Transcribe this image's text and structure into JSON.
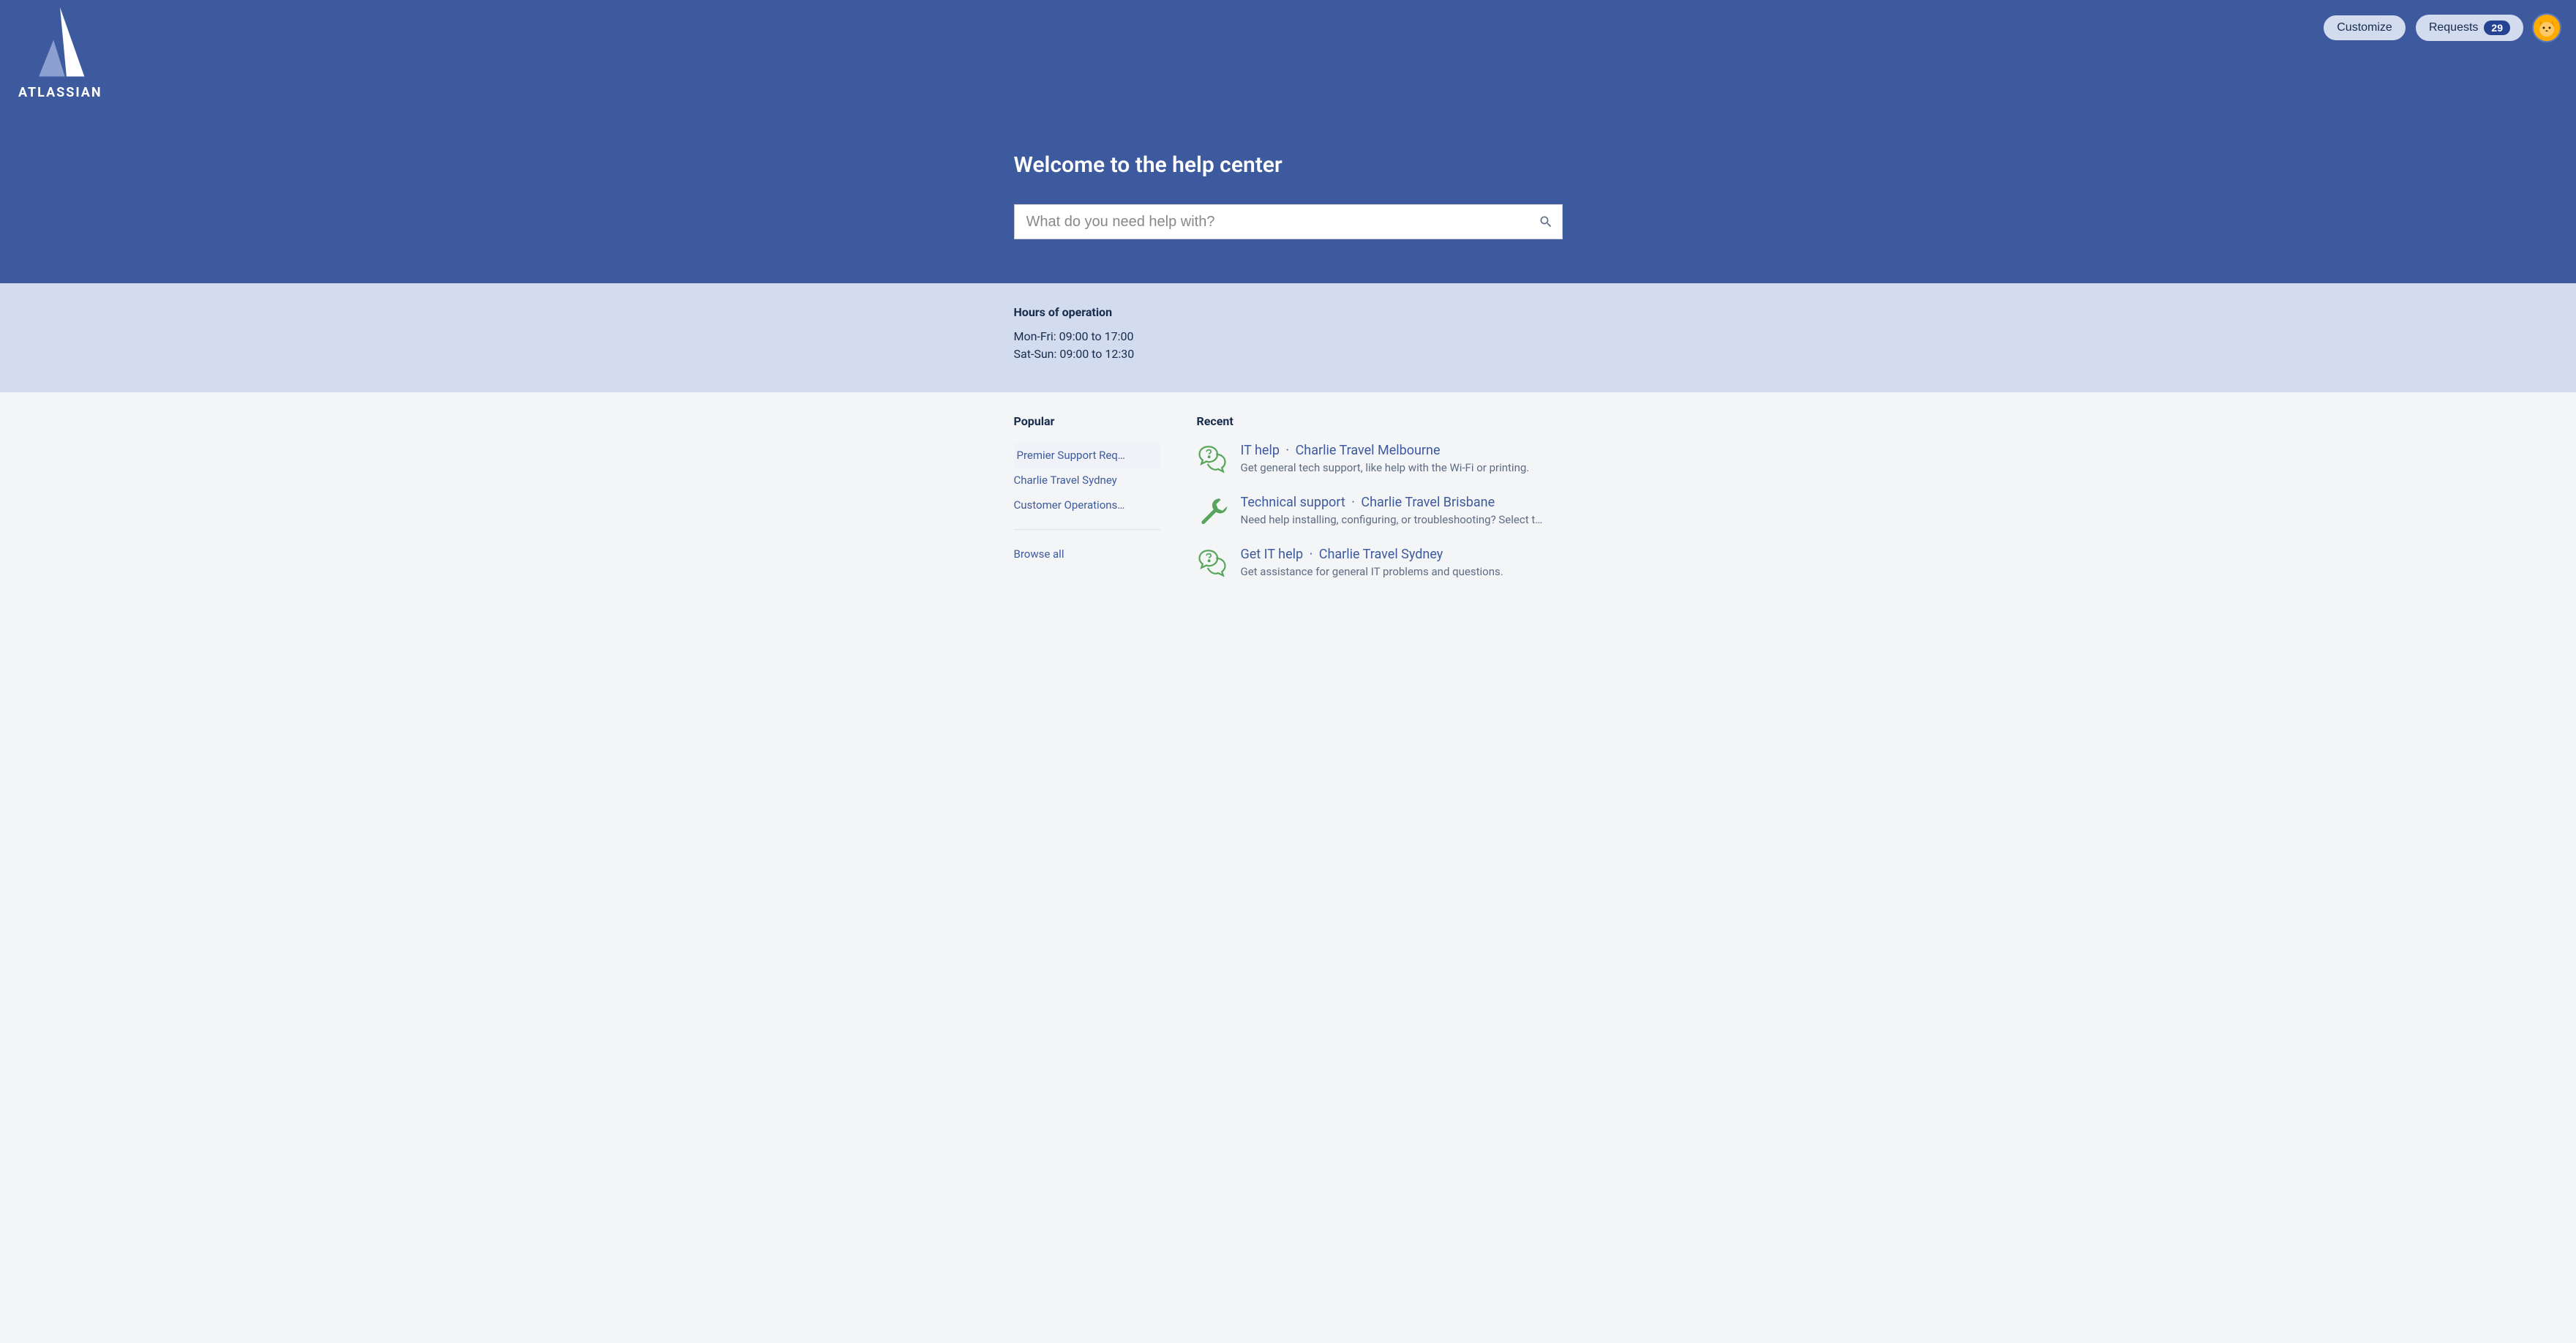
{
  "brand": {
    "name": "ATLASSIAN"
  },
  "header": {
    "customize_label": "Customize",
    "requests_label": "Requests",
    "requests_count": "29"
  },
  "hero": {
    "title": "Welcome to the help center",
    "search_placeholder": "What do you need help with?"
  },
  "hours": {
    "title": "Hours of operation",
    "line1": "Mon-Fri: 09:00 to 17:00",
    "line2": "Sat-Sun: 09:00 to 12:30"
  },
  "popular": {
    "title": "Popular",
    "items": [
      "Premier Support Req…",
      "Charlie Travel Sydney",
      "Customer Operations…"
    ],
    "browse_all": "Browse all"
  },
  "recent": {
    "title": "Recent",
    "items": [
      {
        "icon": "question",
        "title": "IT help",
        "project": "Charlie Travel Melbourne",
        "desc": "Get general tech support, like help with the Wi-Fi or printing."
      },
      {
        "icon": "wrench",
        "title": "Technical support",
        "project": "Charlie Travel Brisbane",
        "desc": "Need help installing, configuring, or troubleshooting? Select t…"
      },
      {
        "icon": "question",
        "title": "Get IT help",
        "project": "Charlie Travel Sydney",
        "desc": "Get assistance for general IT problems and questions."
      }
    ]
  }
}
